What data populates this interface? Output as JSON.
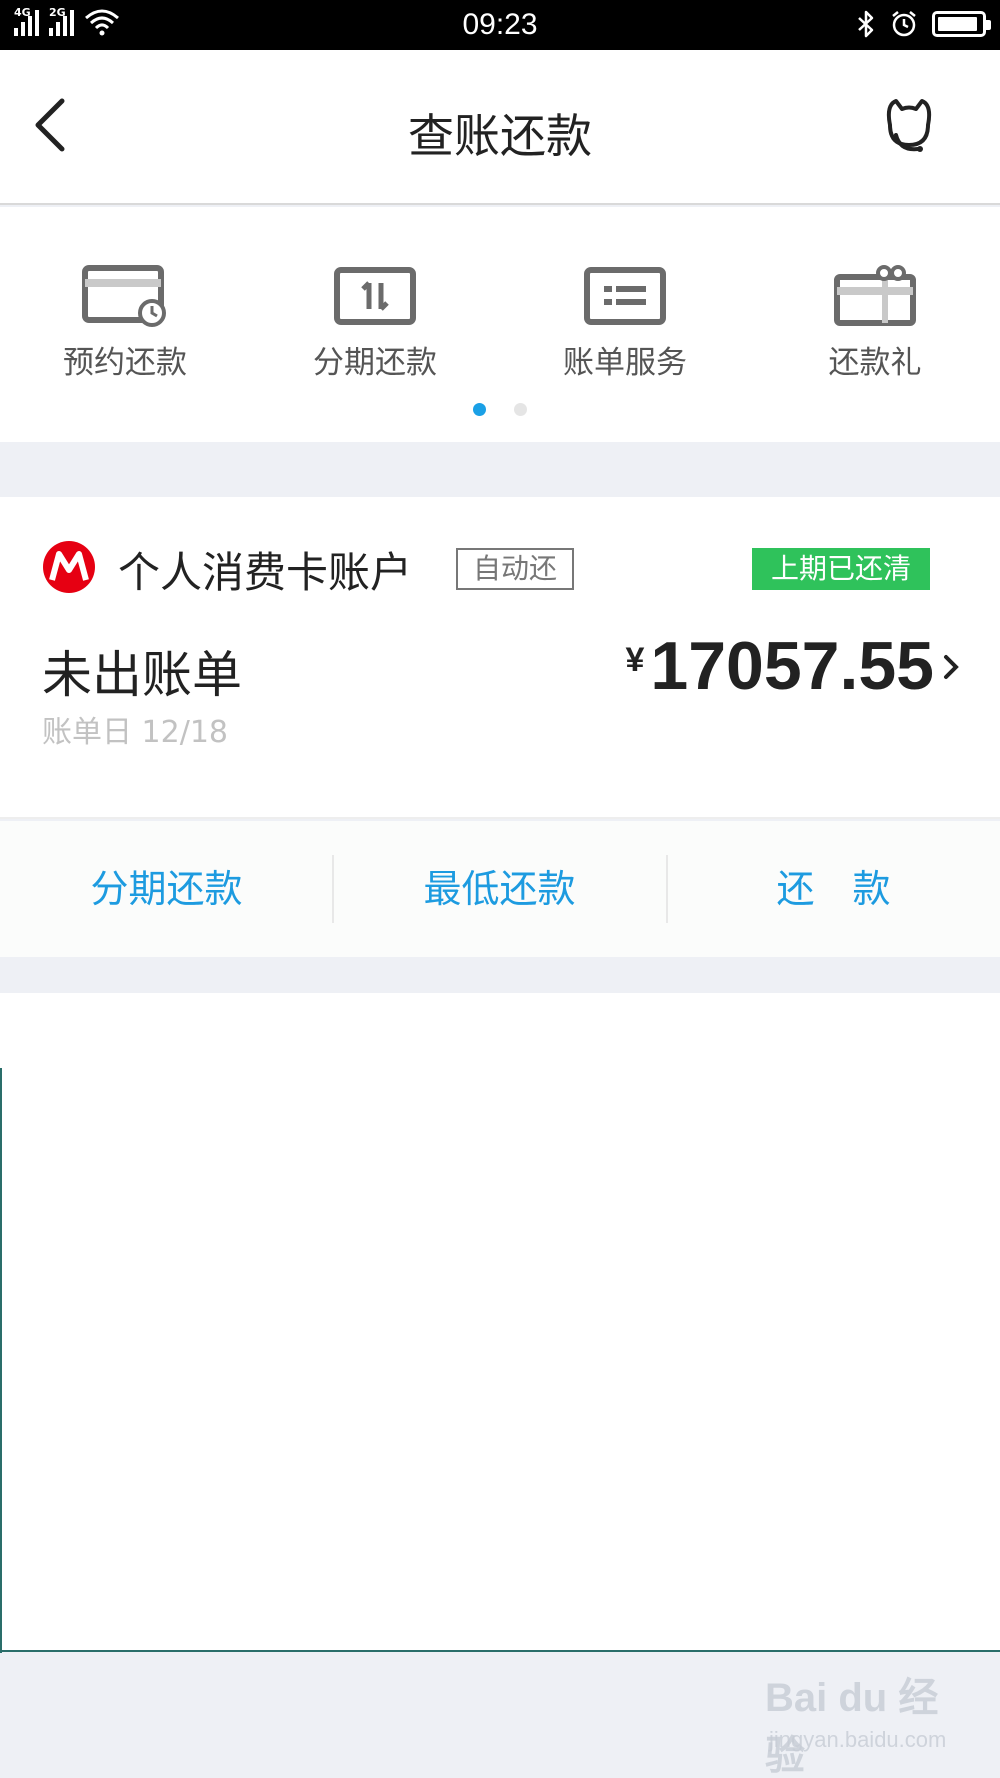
{
  "status_bar": {
    "time": "09:23",
    "network_1": "4G",
    "network_2": "2G",
    "icons": [
      "signal-icon",
      "wifi-icon",
      "bluetooth-icon",
      "alarm-icon",
      "battery-icon"
    ]
  },
  "nav": {
    "title": "查账还款",
    "back_icon": "chevron-left-icon",
    "service_icon": "customer-service-icon"
  },
  "quick_menu": {
    "items": [
      {
        "label": "预约还款",
        "icon": "scheduled-payment-icon"
      },
      {
        "label": "分期还款",
        "icon": "installment-icon"
      },
      {
        "label": "账单服务",
        "icon": "bill-service-icon"
      },
      {
        "label": "还款礼",
        "icon": "gift-icon"
      }
    ],
    "page_count": 2,
    "active_page": 1,
    "accent_color": "#1aa0e6"
  },
  "account": {
    "name": "个人消费卡账户",
    "auto_badge": "自动还",
    "status_badge": "上期已还清",
    "status_color": "#2fc25b",
    "bill_status": "未出账单",
    "bill_date": "账单日 12/18",
    "currency": "¥",
    "amount": "17057.55",
    "logo_color": "#e60012"
  },
  "actions": {
    "installment": "分期还款",
    "minimum": "最低还款",
    "repay": "还　款",
    "color": "#1d9be0"
  },
  "watermark": {
    "main": "Bai du 经验",
    "sub": "jingyan.baidu.com"
  }
}
